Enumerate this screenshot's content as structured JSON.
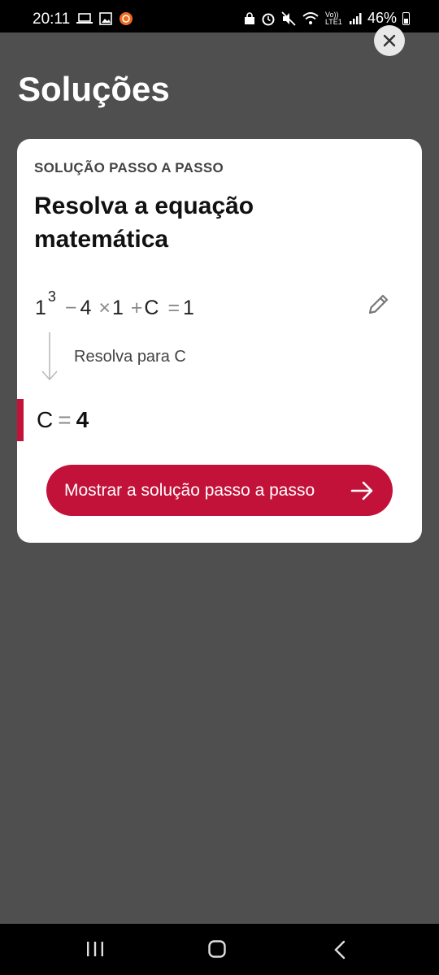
{
  "status_bar": {
    "time": "20:11",
    "battery": "46%",
    "signal_text": "Vo)) LTE1"
  },
  "page": {
    "title": "Soluções"
  },
  "card": {
    "kicker": "SOLUÇÃO PASSO A PASSO",
    "heading": "Resolva a equação matemática",
    "equation": {
      "base": "1",
      "exponent": "3",
      "minus": "−",
      "four": "4",
      "times": "×",
      "one": "1",
      "plus": "+",
      "var": "C",
      "equals": "=",
      "rhs": "1"
    },
    "step_label": "Resolva para C",
    "result": {
      "var": "C",
      "equals": "=",
      "value": "4"
    },
    "cta_label": "Mostrar a solução passo a passo"
  },
  "colors": {
    "accent": "#c2123a",
    "backdrop": "#4f4f4f",
    "card": "#ffffff"
  },
  "icons": [
    "laptop-icon",
    "image-icon",
    "app-notification-icon",
    "alarm-icon",
    "mute-icon",
    "wifi-icon",
    "signal-icon",
    "battery-icon",
    "close-icon",
    "pencil-icon",
    "arrow-down-icon",
    "arrow-right-icon",
    "recents-icon",
    "home-icon",
    "back-icon"
  ]
}
